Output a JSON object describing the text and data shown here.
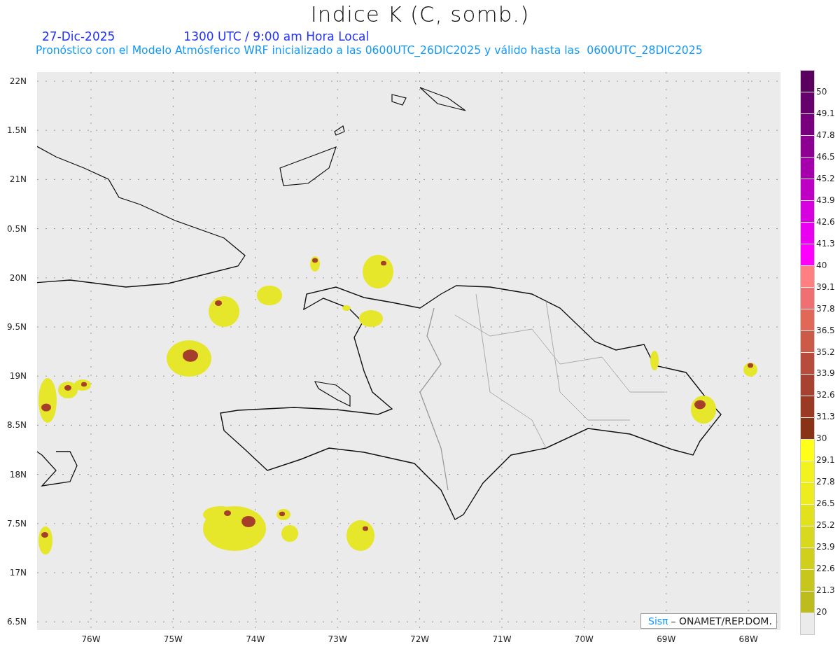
{
  "title": "Indice K (C, somb.)",
  "date": "27-Dic-2025",
  "time": "1300 UTC / 9:00 am Hora Local",
  "subtitle": "Pronóstico con el Modelo Atmósferico WRF inicializado a las 0600UTC_26DIC2025 y válido hasta las  0600UTC_28DIC2025",
  "y_labels": [
    "22N",
    "1.5N",
    "21N",
    "0.5N",
    "20N",
    "9.5N",
    "19N",
    "8.5N",
    "18N",
    "7.5N",
    "17N",
    "6.5N"
  ],
  "x_labels": [
    "76W",
    "75W",
    "74W",
    "73W",
    "72W",
    "71W",
    "70W",
    "69W",
    "68W"
  ],
  "colorbar": [
    {
      "label": "50",
      "color": "#5a005f"
    },
    {
      "label": "49.1",
      "color": "#66006c"
    },
    {
      "label": "47.8",
      "color": "#78007e"
    },
    {
      "label": "46.5",
      "color": "#8c0092"
    },
    {
      "label": "45.2",
      "color": "#a500ab"
    },
    {
      "label": "43.9",
      "color": "#be00c5"
    },
    {
      "label": "42.6",
      "color": "#d700df"
    },
    {
      "label": "41.3",
      "color": "#ea00f0"
    },
    {
      "label": "40",
      "color": "#ff00ff"
    },
    {
      "label": "39.1",
      "color": "#ff8080"
    },
    {
      "label": "37.8",
      "color": "#ef7070"
    },
    {
      "label": "36.5",
      "color": "#df6858"
    },
    {
      "label": "35.2",
      "color": "#cc5a48"
    },
    {
      "label": "33.9",
      "color": "#b84c3c"
    },
    {
      "label": "32.6",
      "color": "#a84230"
    },
    {
      "label": "31.3",
      "color": "#9a3a24"
    },
    {
      "label": "30",
      "color": "#8a3216"
    },
    {
      "label": "29.1",
      "color": "#ffff1a"
    },
    {
      "label": "27.8",
      "color": "#f2f21e"
    },
    {
      "label": "26.5",
      "color": "#ecec1e"
    },
    {
      "label": "25.2",
      "color": "#e2e21c"
    },
    {
      "label": "23.9",
      "color": "#d8d81e"
    },
    {
      "label": "22.6",
      "color": "#d0d01c"
    },
    {
      "label": "21.3",
      "color": "#c6c61c"
    },
    {
      "label": "20",
      "color": "#bcbc1c"
    }
  ],
  "credit": {
    "brand": "Sisπ",
    "text": "– ONAMET/REP.DOM."
  }
}
